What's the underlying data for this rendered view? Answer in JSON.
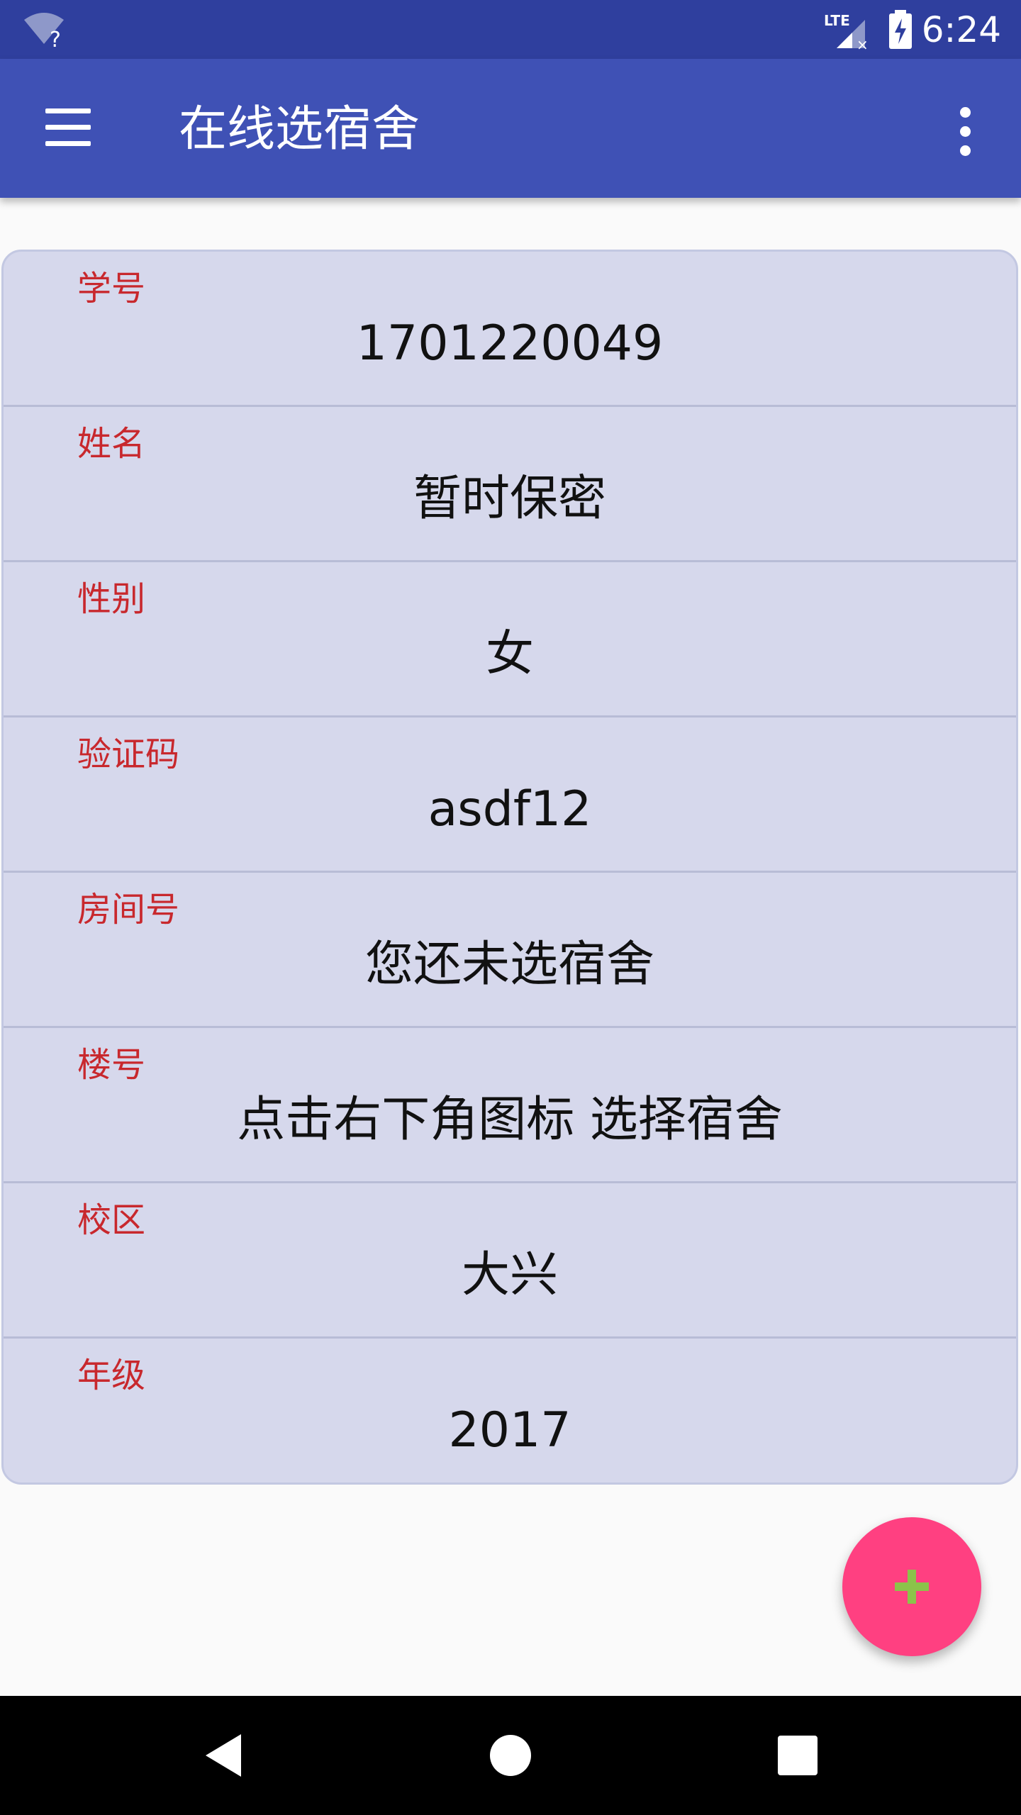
{
  "status_bar": {
    "network": "LTE",
    "time": "6:24",
    "icons": [
      "wifi-unknown-icon",
      "lte-signal-icon",
      "battery-charging-icon"
    ]
  },
  "app_bar": {
    "title": "在线选宿舍",
    "icons": [
      "menu-icon",
      "more-vert-icon"
    ]
  },
  "fields": [
    {
      "label": "学号",
      "value": "1701220049"
    },
    {
      "label": "姓名",
      "value": "暂时保密"
    },
    {
      "label": "性别",
      "value": "女"
    },
    {
      "label": "验证码",
      "value": "asdf12"
    },
    {
      "label": "房间号",
      "value": "您还未选宿舍"
    },
    {
      "label": "楼号",
      "value": "点击右下角图标 选择宿舍"
    },
    {
      "label": "校区",
      "value": "大兴"
    },
    {
      "label": "年级",
      "value": "2017"
    }
  ],
  "fab": {
    "icon": "add-icon"
  },
  "nav_bar": {
    "icons": [
      "back-icon",
      "home-icon",
      "recents-icon"
    ]
  },
  "colors": {
    "status_bar": "#2f3f9e",
    "app_bar": "#3f51b5",
    "card_background": "#d6d8ec",
    "label": "#c8282d",
    "fab": "#ff4081",
    "fab_icon": "#8bc34a"
  }
}
